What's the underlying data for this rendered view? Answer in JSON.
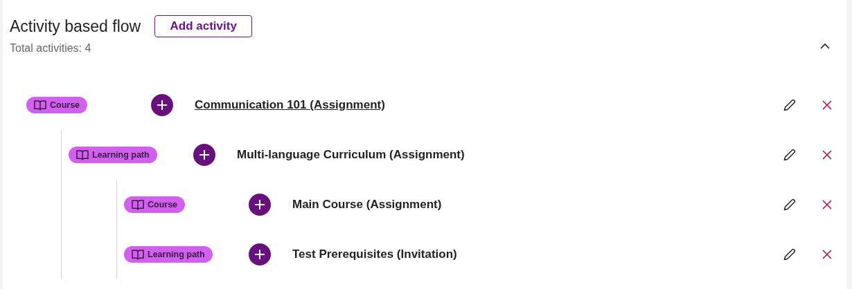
{
  "header": {
    "title": "Activity based flow",
    "add_button": "Add activity",
    "total": "Total activities: 4",
    "expanded": true
  },
  "activities": [
    {
      "type": "Course",
      "title": "Communication 101 (Assignment)",
      "underlined": true,
      "children": [
        {
          "type": "Learning path",
          "title": "Multi-language Curriculum (Assignment)",
          "underlined": false,
          "children": [
            {
              "type": "Course",
              "title": "Main Course (Assignment)",
              "underlined": false
            },
            {
              "type": "Learning path",
              "title": "Test Prerequisites (Invitation)",
              "underlined": false
            }
          ]
        }
      ]
    }
  ]
}
